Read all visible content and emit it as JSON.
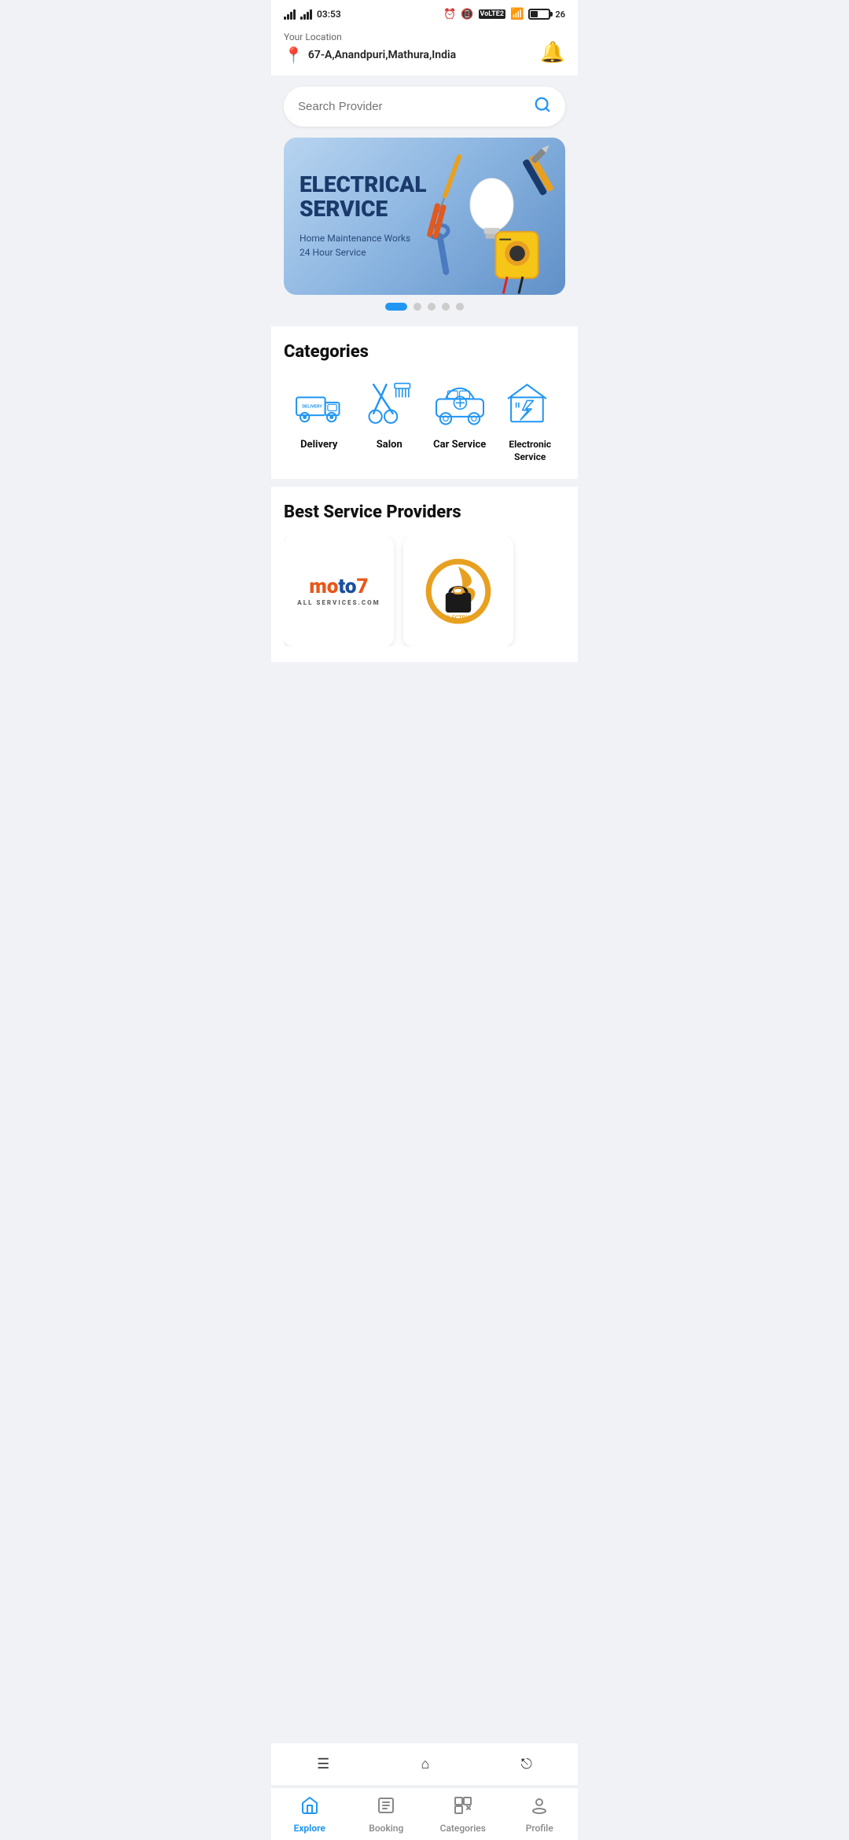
{
  "statusBar": {
    "time": "03:53",
    "battery": "26"
  },
  "header": {
    "locationLabel": "Your Location",
    "locationValue": "67-A,Anandpuri,Mathura,India"
  },
  "search": {
    "placeholder": "Search Provider"
  },
  "banner": {
    "title": "ELECTRICAL\nSERVICE",
    "subtitle": "Home Maintenance Works\n24 Hour Service"
  },
  "carouselDots": [
    true,
    false,
    false,
    false,
    false
  ],
  "categories": {
    "title": "Categories",
    "items": [
      {
        "label": "Delivery",
        "icon": "delivery"
      },
      {
        "label": "Salon",
        "icon": "salon"
      },
      {
        "label": "Car Service",
        "icon": "car-service"
      },
      {
        "label": "Electronic\nService",
        "icon": "electronic"
      }
    ]
  },
  "providers": {
    "title": "Best Service Providers",
    "items": [
      {
        "name": "Moto7",
        "type": "moto"
      },
      {
        "name": "Electric",
        "type": "electric"
      }
    ]
  },
  "bottomNav": {
    "items": [
      {
        "label": "Explore",
        "icon": "home",
        "active": true
      },
      {
        "label": "Booking",
        "icon": "booking",
        "active": false
      },
      {
        "label": "Categories",
        "icon": "categories",
        "active": false
      },
      {
        "label": "Profile",
        "icon": "profile",
        "active": false
      }
    ]
  }
}
